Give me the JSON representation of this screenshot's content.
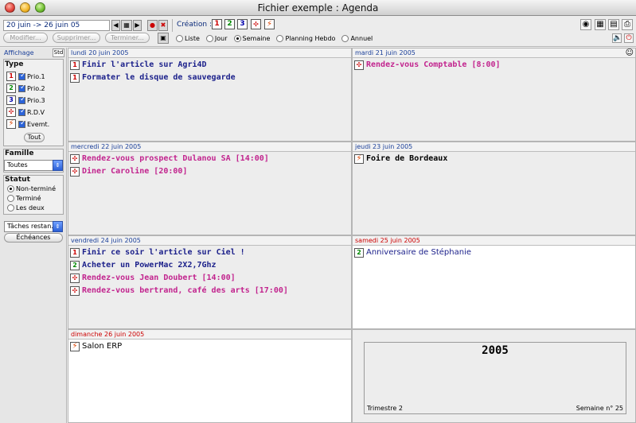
{
  "window": {
    "title": "Fichier exemple : Agenda"
  },
  "toolbar": {
    "date_range": "20 juin -> 26 juin 05",
    "creation_label": "Création :",
    "prio_buttons": [
      "1",
      "2",
      "3"
    ],
    "buttons": {
      "modifier": "Modifier...",
      "supprimer": "Supprimer...",
      "terminer": "Terminer..."
    },
    "views": [
      "Liste",
      "Jour",
      "Semaine",
      "Planning Hebdo",
      "Annuel"
    ],
    "selected_view": "Semaine"
  },
  "sidebar": {
    "affichage": "Affichage",
    "std": "Std",
    "type_title": "Type",
    "types": [
      {
        "icon": "1",
        "label": "Prio.1"
      },
      {
        "icon": "2",
        "label": "Prio.2"
      },
      {
        "icon": "3",
        "label": "Prio.3"
      },
      {
        "icon": "rdv",
        "label": "R.D.V"
      },
      {
        "icon": "event",
        "label": "Evemt."
      }
    ],
    "tout": "Tout",
    "famille_title": "Famille",
    "famille_value": "Toutes",
    "statut_title": "Statut",
    "statut": [
      "Non-terminé",
      "Terminé",
      "Les deux"
    ],
    "taches": "Tâches restan...",
    "echeances": "Échéances"
  },
  "days": {
    "mon": {
      "label": "lundi 20 juin 2005",
      "events": [
        {
          "type": "1",
          "text": "Finir l'article sur Agri4D"
        },
        {
          "type": "1",
          "text": "Formater le disque de sauvegarde"
        }
      ]
    },
    "tue": {
      "label": "mardi 21 juin 2005",
      "events": [
        {
          "type": "rdv",
          "text": "Rendez-vous Comptable [8:00]"
        }
      ]
    },
    "wed": {
      "label": "mercredi 22 juin 2005",
      "events": [
        {
          "type": "rdv",
          "text": "Rendez-vous prospect Dulanou SA [14:00]"
        },
        {
          "type": "rdv",
          "text": "Diner Caroline [20:00]"
        }
      ]
    },
    "thu": {
      "label": "jeudi 23 juin 2005",
      "events": [
        {
          "type": "event",
          "text": "Foire de Bordeaux"
        }
      ]
    },
    "fri": {
      "label": "vendredi 24 juin 2005",
      "events": [
        {
          "type": "1",
          "text": "Finir ce soir l'article sur Ciel !"
        },
        {
          "type": "2",
          "text": "Acheter un PowerMac 2X2,7Ghz"
        },
        {
          "type": "rdv",
          "text": "Rendez-vous Jean Doubert [14:00]"
        },
        {
          "type": "rdv",
          "text": "Rendez-vous bertrand, café des arts [17:00]"
        }
      ]
    },
    "sat": {
      "label": "samedi 25 juin 2005",
      "events": [
        {
          "type": "2",
          "text": "Anniversaire de Stéphanie"
        }
      ]
    },
    "sun": {
      "label": "dimanche 26 juin 2005",
      "events": [
        {
          "type": "event",
          "text": "Salon ERP"
        }
      ]
    }
  },
  "summary": {
    "year": "2005",
    "trimestre": "Trimestre 2",
    "semaine": "Semaine n° 25"
  }
}
